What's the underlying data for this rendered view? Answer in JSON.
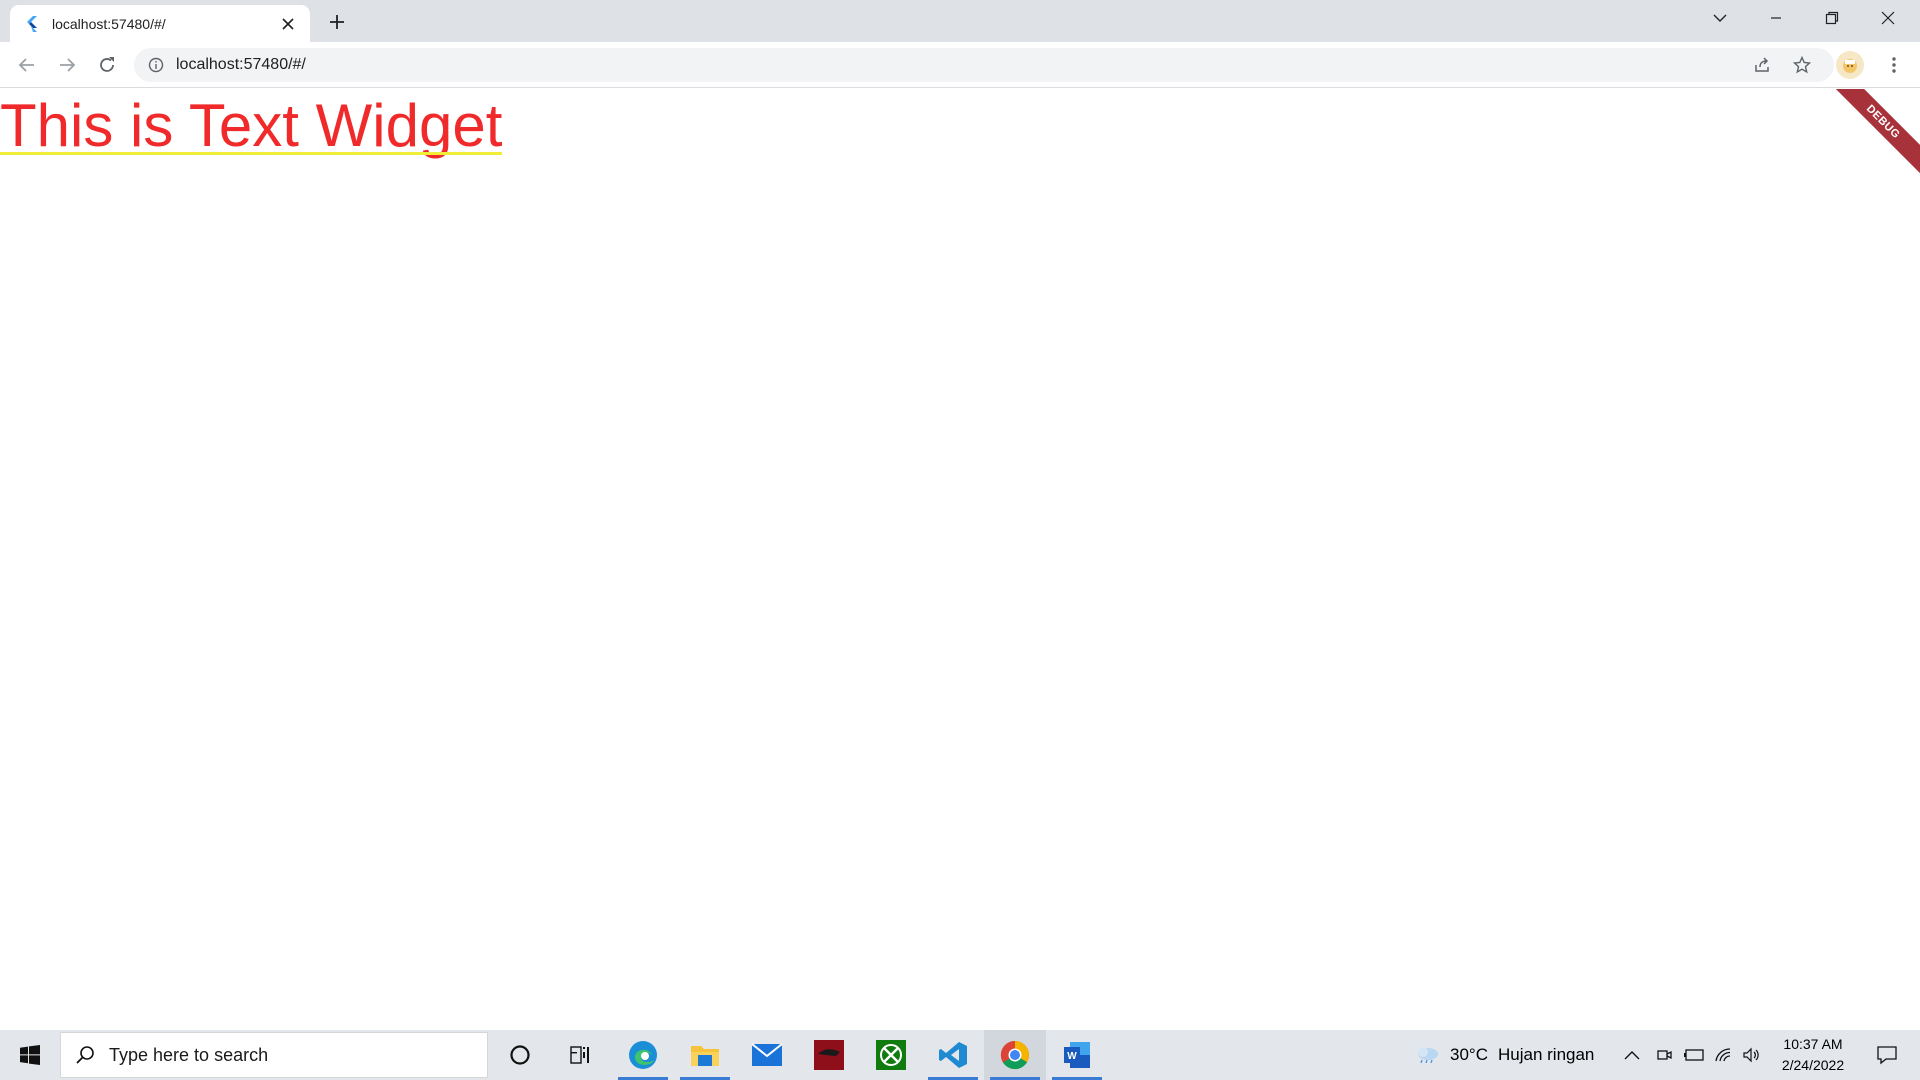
{
  "browser": {
    "tab_title": "localhost:57480/#/",
    "url": "localhost:57480/#/"
  },
  "page": {
    "text_widget": "This is Text Widget",
    "debug_banner": "DEBUG"
  },
  "taskbar": {
    "search_placeholder": "Type here to search",
    "apps": [
      "cortana",
      "task-view",
      "edge",
      "file-explorer",
      "mail",
      "app-red",
      "xbox",
      "vscode",
      "chrome",
      "word"
    ],
    "weather": {
      "temp": "30°C",
      "desc": "Hujan ringan"
    },
    "time": "10:37 AM",
    "date": "2/24/2022"
  },
  "colors": {
    "text_widget": "#f02a2a",
    "underline": "#f1ee3a",
    "debug_banner": "#a8323a",
    "tab_strip": "#dee1e6",
    "taskbar": "#e3e7ec"
  }
}
